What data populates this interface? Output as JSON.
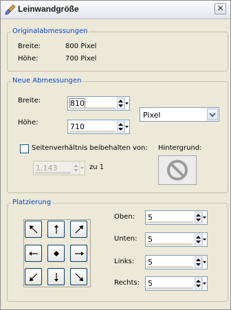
{
  "window": {
    "title": "Leinwandgröße",
    "close_glyph": "✕"
  },
  "original": {
    "legend": "Originalabmessungen",
    "width_label": "Breite:",
    "width_value": "800 Pixel",
    "height_label": "Höhe:",
    "height_value": "700 Pixel"
  },
  "new_dims": {
    "legend": "Neue Abmessungen",
    "width_label": "Breite:",
    "width_value": "810",
    "height_label": "Höhe:",
    "height_value": "710",
    "unit": "Pixel",
    "keep_ratio_label": "Seitenverhältnis beibehalten von:",
    "keep_ratio_checked": false,
    "ratio_value": "1,143",
    "ratio_suffix": "zu 1",
    "background_label": "Hintergrund:",
    "background_icon": "no-color-icon"
  },
  "placement": {
    "legend": "Platzierung",
    "buttons": [
      "arrow-up-left-icon",
      "arrow-up-icon",
      "arrow-up-right-icon",
      "arrow-left-icon",
      "center-dot-icon",
      "arrow-right-icon",
      "arrow-down-left-icon",
      "arrow-down-icon",
      "arrow-down-right-icon"
    ],
    "top_label": "Oben:",
    "top_value": "5",
    "bottom_label": "Unten:",
    "bottom_value": "5",
    "left_label": "Links:",
    "left_value": "5",
    "right_label": "Rechts:",
    "right_value": "5"
  },
  "colors": {
    "legend": "#0046d5",
    "border": "#7f9db9",
    "face": "#ece9d8"
  }
}
